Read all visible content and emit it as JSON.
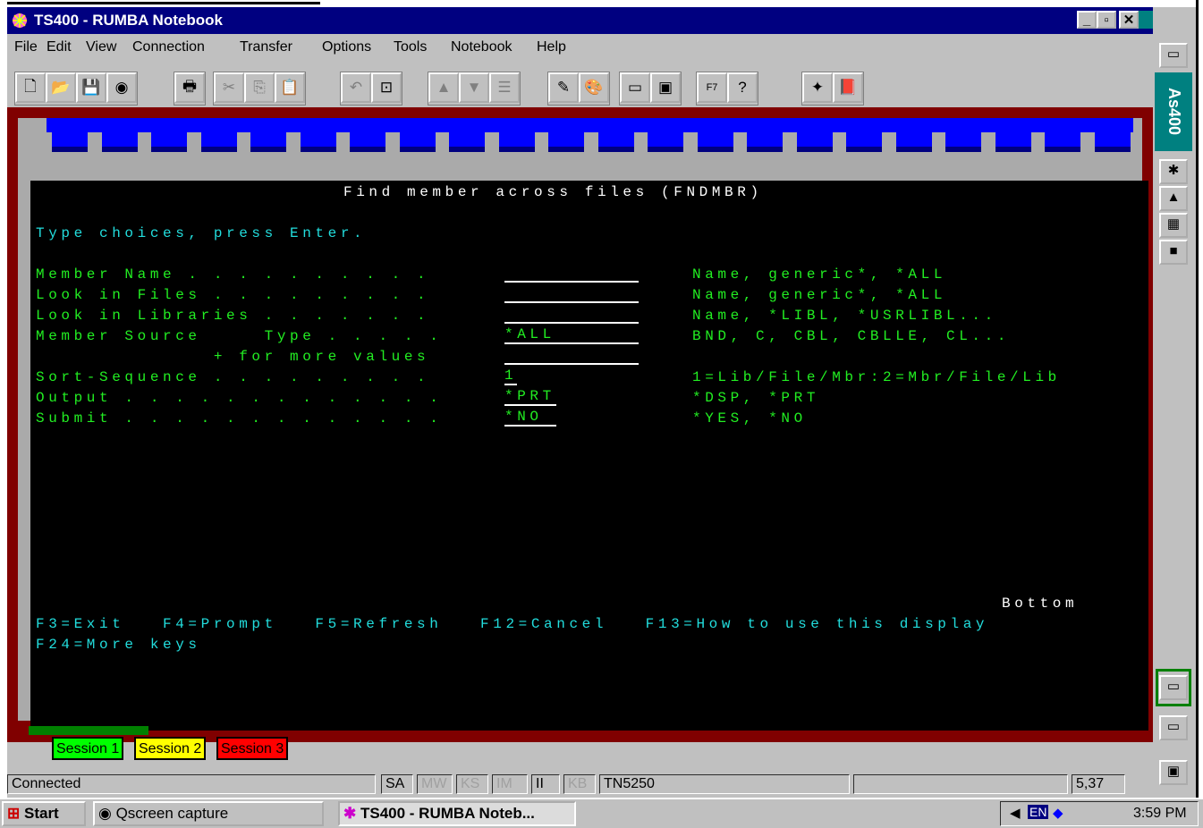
{
  "window": {
    "title": "TS400 - RUMBA Notebook",
    "min": "_",
    "max": "▫",
    "close": "✕"
  },
  "menu": [
    {
      "label": "File"
    },
    {
      "label": "Edit"
    },
    {
      "label": "View"
    },
    {
      "label": "Connection"
    },
    {
      "label": "Transfer"
    },
    {
      "label": "Options"
    },
    {
      "label": "Tools"
    },
    {
      "label": "Notebook"
    },
    {
      "label": "Help"
    }
  ],
  "toolbar": {
    "f7": "F7"
  },
  "terminal": {
    "title": "Find member across files (FNDMBR)",
    "instruction": "Type choices, press Enter.",
    "rows": [
      {
        "label": "Member Name . . . . . . . . . .",
        "value": "",
        "hint": "Name, generic*, *ALL"
      },
      {
        "label": "Look in Files . . . . . . . . .",
        "value": "",
        "hint": "Name, generic*, *ALL"
      },
      {
        "label": "Look in Libraries . . . . . . .",
        "value": "",
        "hint": "Name, *LIBL, *USRLIBL..."
      },
      {
        "label": "Member Source     Type . . . . .",
        "value": "*ALL",
        "hint": "BND, C, CBL, CBLLE, CL..."
      },
      {
        "label": "              + for more values",
        "value": "",
        "hint": ""
      },
      {
        "label": "Sort-Sequence . . . . . . . . .",
        "value": "1",
        "hint": "1=Lib/File/Mbr:2=Mbr/File/Lib"
      },
      {
        "label": "Output . . . . . . . . . . . . .",
        "value": "*PRT",
        "hint": "*DSP, *PRT"
      },
      {
        "label": "Submit . . . . . . . . . . . . .",
        "value": "*NO",
        "hint": "*YES, *NO"
      }
    ],
    "bottom": "Bottom",
    "fkeys1": "F3=Exit   F4=Prompt   F5=Refresh   F12=Cancel   F13=How to use this display",
    "fkeys2": "F24=More keys"
  },
  "sessions": [
    {
      "label": "Session 1",
      "color": "#00ff00"
    },
    {
      "label": "Session 2",
      "color": "#ffff00"
    },
    {
      "label": "Session 3",
      "color": "#ff0000"
    }
  ],
  "status": {
    "connection": "Connected",
    "sa": "SA",
    "mw": "MW",
    "ks": "KS",
    "im": "IM",
    "ii": "II",
    "kb": "KB",
    "protocol": "TN5250",
    "cursor": "5,37"
  },
  "taskbar": {
    "start": "Start",
    "task1": "Qscreen capture",
    "task2": "TS400 - RUMBA Noteb...",
    "lang": "EN",
    "clock": "3:59 PM"
  },
  "sidebar": {
    "tab_label": "As400"
  }
}
